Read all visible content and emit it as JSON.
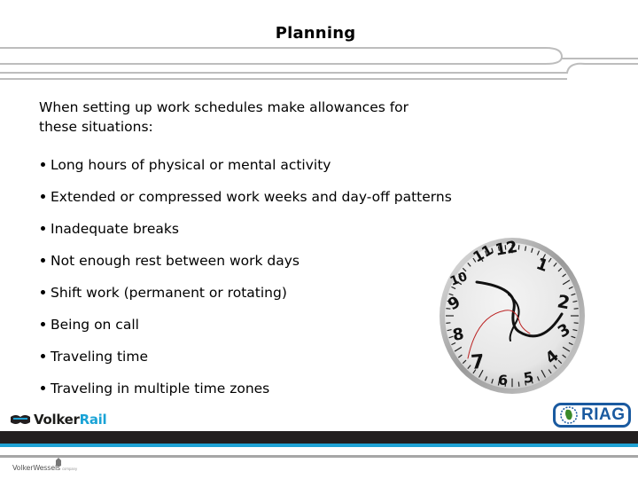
{
  "slide": {
    "title": "Planning",
    "intro": "When setting up work schedules make allowances for these situations:",
    "intro_line1": "When setting up work schedules make allowances for",
    "intro_line2": "these situations:",
    "bullets": [
      "Long hours of physical or mental activity",
      "Extended or compressed work weeks and day-off patterns",
      "Inadequate breaks",
      "Not enough rest between work days",
      "Shift work (permanent or rotating)",
      "Being on call",
      "Traveling time",
      "Traveling in multiple time zones"
    ]
  },
  "image": {
    "description": "warped melting clock",
    "icon": "clock-icon"
  },
  "footer": {
    "left_logo": {
      "part1": "Volker",
      "part2": "Rail"
    },
    "right_logo": {
      "text": "RIAG"
    },
    "bottom_logo": {
      "text": "VolkerWessels",
      "sub": "company"
    }
  },
  "colors": {
    "brand_dark": "#231f20",
    "brand_blue": "#1fa2d4",
    "riag_blue": "#1a5aa0",
    "line_grey": "#bdbdbd"
  }
}
